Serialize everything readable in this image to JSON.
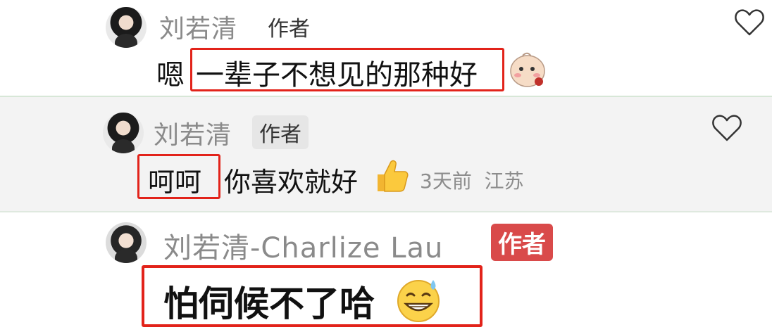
{
  "comments": [
    {
      "author": "刘若清",
      "author_tag": "作者",
      "text_prefix": "嗯",
      "text_highlighted": "一辈子不想见的那种好",
      "emoji": "shy-face-icon",
      "like_icon": "heart-outline-icon"
    },
    {
      "author": "刘若清",
      "author_tag": "作者",
      "text_highlighted": "呵呵",
      "text_rest": "你喜欢就好",
      "emoji": "thumbs-up-icon",
      "time": "3天前",
      "location": "江苏",
      "like_icon": "heart-outline-icon"
    },
    {
      "author": "刘若清-Charlize Lau",
      "author_tag": "作者",
      "text_highlighted": "怕伺候不了哈",
      "emoji": "grinning-sweat-icon"
    }
  ],
  "colors": {
    "highlight_border": "#e2231a",
    "author_badge": "#d94a4a",
    "divider": "#d7e7d7"
  }
}
